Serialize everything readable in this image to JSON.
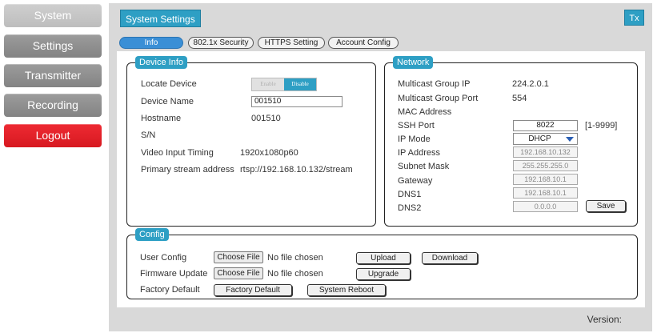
{
  "nav": {
    "system": "System",
    "settings": "Settings",
    "transmitter": "Transmitter",
    "recording": "Recording",
    "logout": "Logout"
  },
  "header": {
    "title": "System Settings",
    "badge": "Tx"
  },
  "tabs": {
    "info": "Info",
    "security": "802.1x Security",
    "https": "HTTPS Setting",
    "account": "Account Config"
  },
  "device_info": {
    "legend": "Device Info",
    "locate_label": "Locate Device",
    "locate_enable": "Enable",
    "locate_disable": "Disable",
    "name_label": "Device Name",
    "name_value": "001510",
    "hostname_label": "Hostname",
    "hostname_value": "001510",
    "sn_label": "S/N",
    "sn_value": "",
    "timing_label": "Video Input Timing",
    "timing_value": "1920x1080p60",
    "stream_label": "Primary stream address",
    "stream_value": "rtsp://192.168.10.132/stream"
  },
  "network": {
    "legend": "Network",
    "mcast_ip_label": "Multicast Group IP",
    "mcast_ip_value": "224.2.0.1",
    "mcast_port_label": "Multicast Group Port",
    "mcast_port_value": "554",
    "mac_label": "MAC Address",
    "mac_value": "",
    "ssh_label": "SSH Port",
    "ssh_value": "8022",
    "ssh_range": "[1-9999]",
    "ipmode_label": "IP Mode",
    "ipmode_value": "DHCP",
    "ip_label": "IP Address",
    "ip_value": "192.168.10.132",
    "mask_label": "Subnet Mask",
    "mask_value": "255.255.255.0",
    "gateway_label": "Gateway",
    "gateway_value": "192.168.10.1",
    "dns1_label": "DNS1",
    "dns1_value": "192.168.10.1",
    "dns2_label": "DNS2",
    "dns2_value": "0.0.0.0",
    "save": "Save"
  },
  "config": {
    "legend": "Config",
    "user_label": "User Config",
    "firmware_label": "Firmware Update",
    "factory_label": "Factory Default",
    "choose_file": "Choose File",
    "no_file": "No file chosen",
    "upload": "Upload",
    "download": "Download",
    "upgrade": "Upgrade",
    "factory_btn": "Factory Default",
    "reboot": "System Reboot"
  },
  "footer": {
    "version_label": "Version:"
  },
  "colors": {
    "accent": "#2e9fc4",
    "active_tab": "#3a8fd6",
    "logout": "#e32027"
  }
}
